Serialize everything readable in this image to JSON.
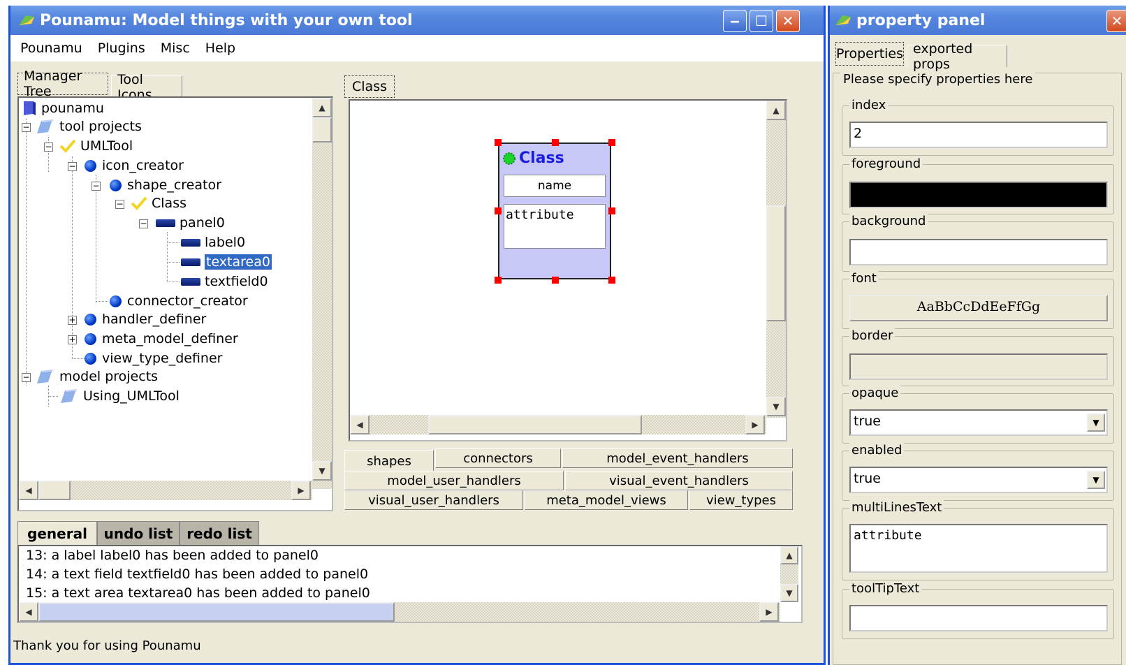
{
  "main_window": {
    "title": "Pounamu: Model things with your own tool",
    "buttons": {
      "minimize": "‒",
      "maximize": "☐",
      "close": "✕"
    }
  },
  "menubar": {
    "items": [
      "Pounamu",
      "Plugins",
      "Misc",
      "Help"
    ]
  },
  "left_tabs": {
    "manager_tree": "Manager Tree",
    "tool_icons": "Tool Icons"
  },
  "tree": {
    "pounamu": "pounamu",
    "tool_projects": "tool projects",
    "umltool": "UMLTool",
    "icon_creator": "icon_creator",
    "shape_creator": "shape_creator",
    "class": "Class",
    "panel0": "panel0",
    "label0": "label0",
    "textarea0": "textarea0",
    "textfield0": "textfield0",
    "connector_creator": "connector_creator",
    "handler_definer": "handler_definer",
    "meta_model_definer": "meta_model_definer",
    "view_type_definer": "view_type_definer",
    "model_projects": "model projects",
    "using_umltool": "Using_UMLTool",
    "expand_minus": "−",
    "expand_plus": "+"
  },
  "canvas": {
    "tab": "Class",
    "shape": {
      "title": "Class",
      "name_field": "name",
      "attribute_area": "attribute"
    }
  },
  "bottom_tabs": {
    "row1": [
      "shapes",
      "connectors",
      "model_event_handlers"
    ],
    "row2": [
      "model_user_handlers",
      "visual_event_handlers"
    ],
    "row3": [
      "visual_user_handlers",
      "meta_model_views",
      "view_types"
    ]
  },
  "log_tabs": {
    "general": "general",
    "undo": "undo list",
    "redo": "redo list"
  },
  "log_lines": [
    "13: a label label0 has been added to panel0",
    "14: a text field textfield0 has been added to panel0",
    "15: a text area textarea0 has been added to panel0"
  ],
  "status_bar": "Thank you for using Pounamu",
  "property_panel": {
    "title": "property panel",
    "close": "✕",
    "tabs": {
      "properties": "Properties",
      "exported": "exported props"
    },
    "header": "Please specify properties here",
    "index": {
      "label": "index",
      "value": "2"
    },
    "foreground": {
      "label": "foreground",
      "color": "#000000"
    },
    "background": {
      "label": "background",
      "color": "#ffffff"
    },
    "font": {
      "label": "font",
      "sample": "AaBbCcDdEeFfGg"
    },
    "border": {
      "label": "border"
    },
    "opaque": {
      "label": "opaque",
      "value": "true"
    },
    "enabled": {
      "label": "enabled",
      "value": "true"
    },
    "multiLinesText": {
      "label": "multiLinesText",
      "value": "attribute"
    },
    "toolTipText": {
      "label": "toolTipText",
      "value": ""
    }
  },
  "scroll_arrows": {
    "up": "▲",
    "down": "▼",
    "left": "◀",
    "right": "▶"
  },
  "colors": {
    "titlebar": "#4a7ad6",
    "window_bg": "#ECE9D8",
    "selection": "#316AC5",
    "shape_fill": "#C8C8F8",
    "handle": "#ff0000"
  }
}
